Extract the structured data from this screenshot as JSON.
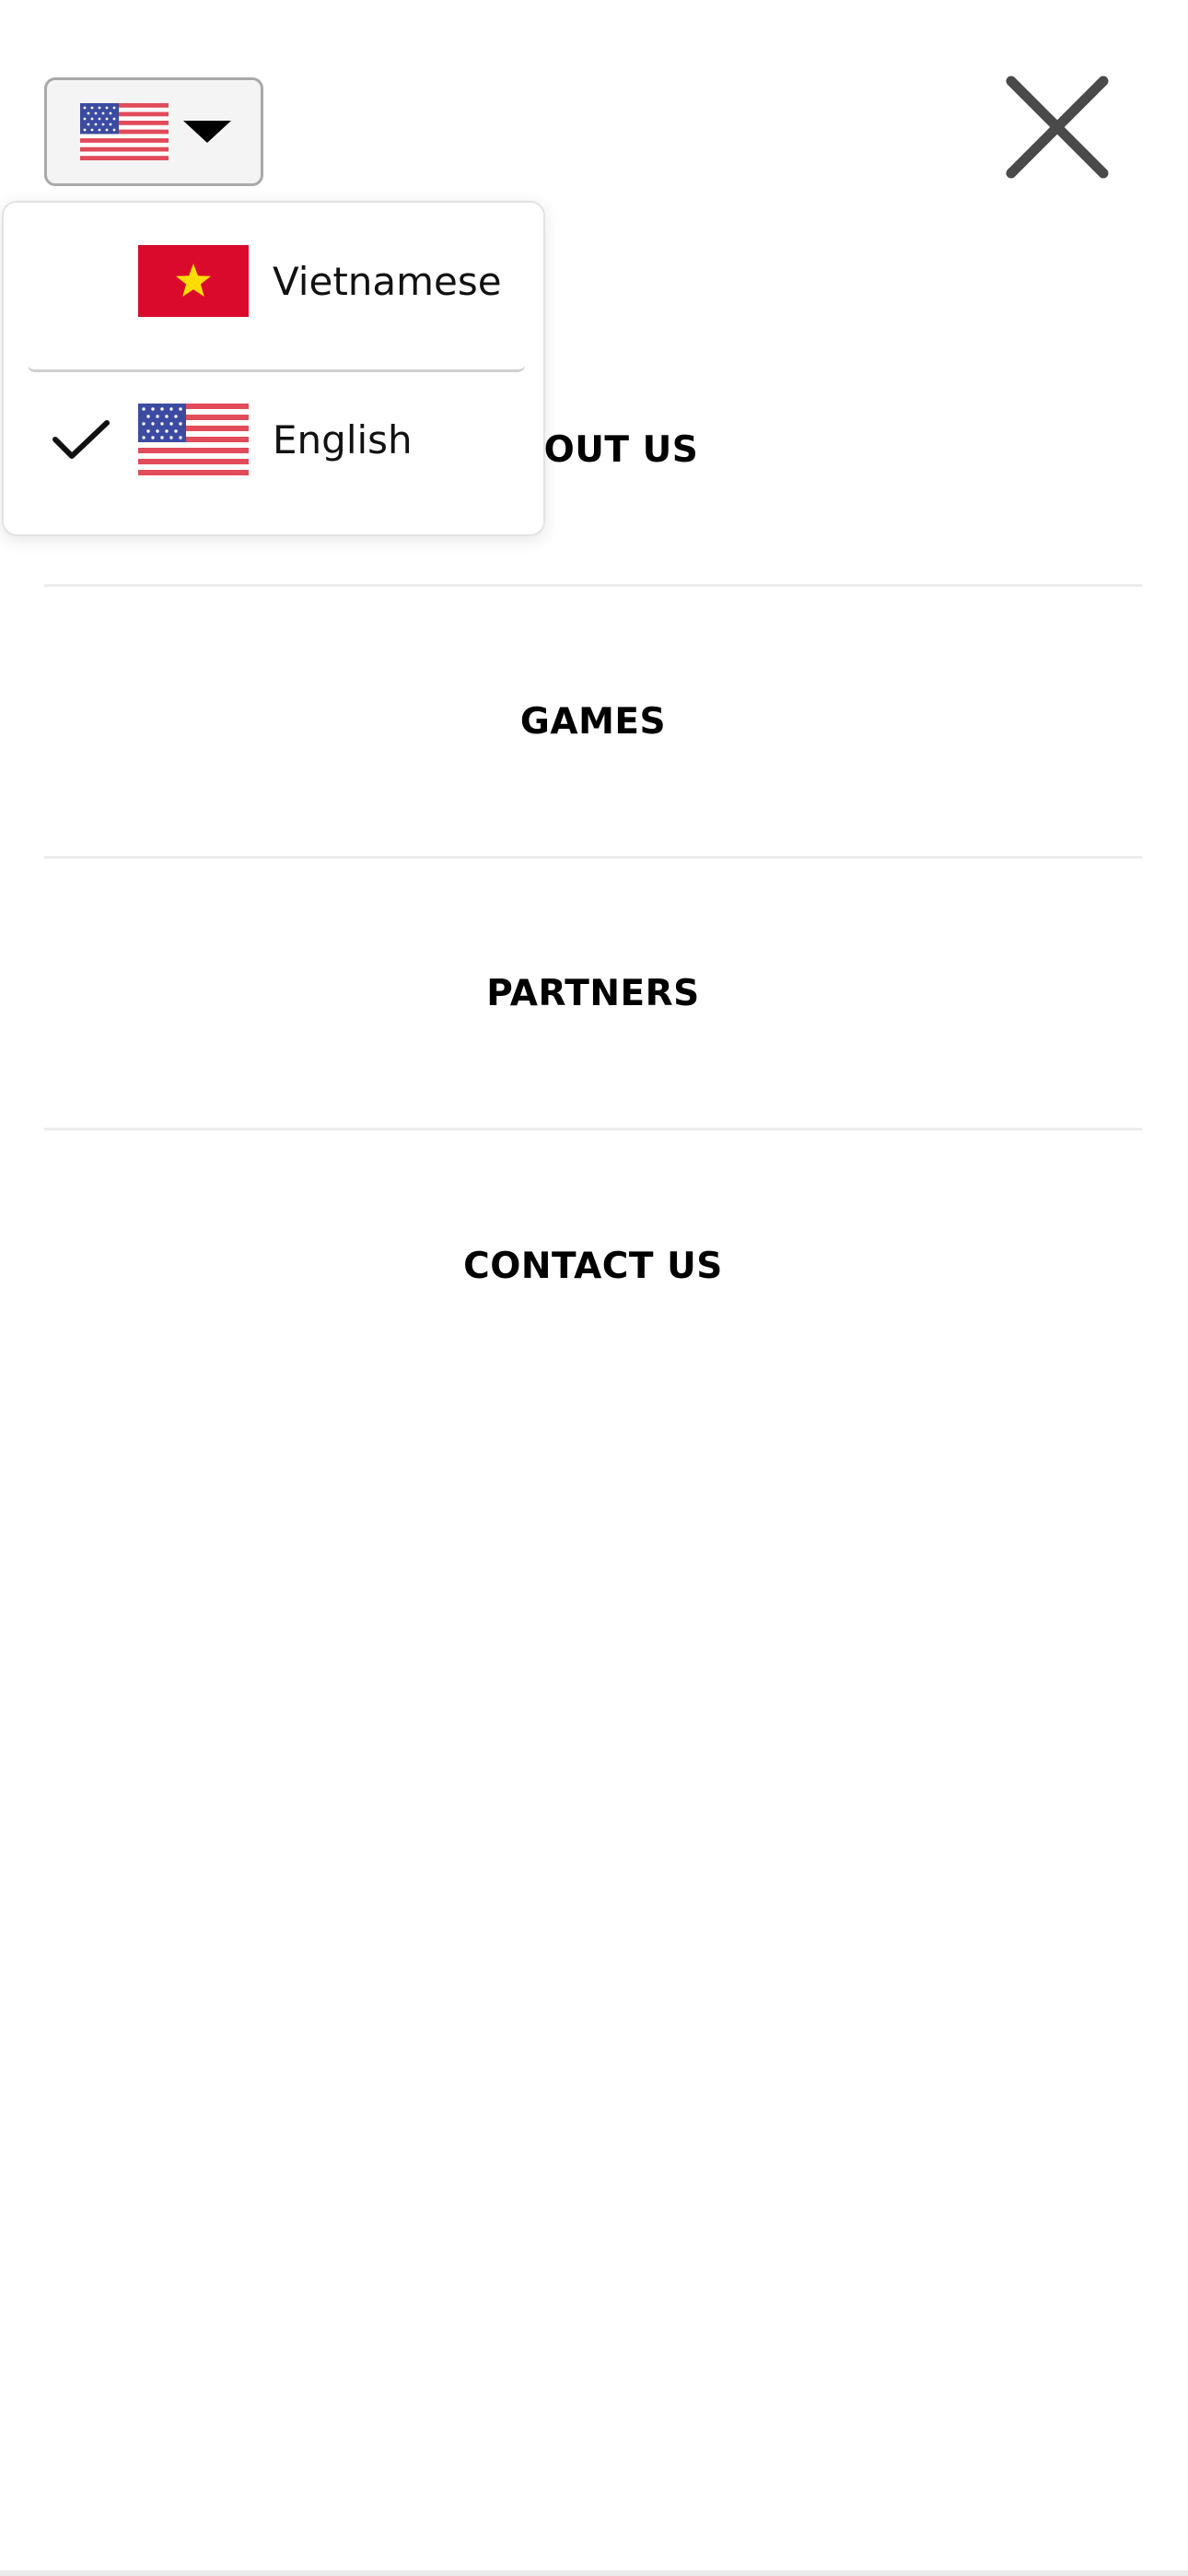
{
  "header": {
    "language_button": {
      "current_language": "English",
      "flag_icon": "us-flag-icon",
      "caret_icon": "caret-down-icon"
    },
    "close_icon": "close-icon"
  },
  "language_dropdown": {
    "options": [
      {
        "label": "Vietnamese",
        "flag_icon": "vietnam-flag-icon",
        "selected": false
      },
      {
        "label": "English",
        "flag_icon": "us-flag-icon",
        "selected": true
      }
    ],
    "check_icon": "checkmark-icon"
  },
  "menu": {
    "items": [
      {
        "label": "ABOUT US"
      },
      {
        "label": "GAMES"
      },
      {
        "label": "PARTNERS"
      },
      {
        "label": "CONTACT US"
      }
    ]
  },
  "colors": {
    "background": "#ffffff",
    "text": "#000000",
    "divider": "#ececec",
    "vietnam_red": "#da0a2c",
    "vietnam_star": "#ffdd00",
    "us_red": "#e14b5a",
    "us_blue": "#3c4ba1",
    "close_icon": "#4a4a4a"
  }
}
